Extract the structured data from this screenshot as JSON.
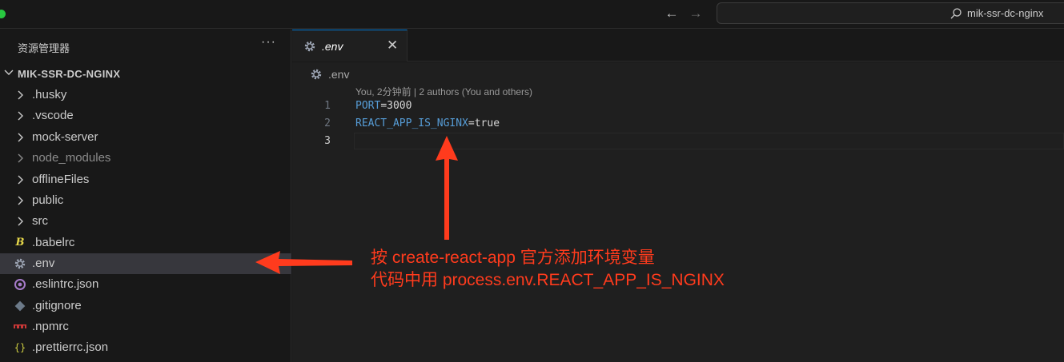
{
  "titlebar": {
    "search_text": "mik-ssr-dc-nginx",
    "back_icon": "arrow-left-icon",
    "forward_icon": "arrow-right-icon",
    "search_icon": "search-icon"
  },
  "sidebar": {
    "title": "资源管理器",
    "more": "···",
    "root_label": "MIK-SSR-DC-NGINX",
    "items": [
      {
        "label": ".husky",
        "type": "folder"
      },
      {
        "label": ".vscode",
        "type": "folder"
      },
      {
        "label": "mock-server",
        "type": "folder"
      },
      {
        "label": "node_modules",
        "type": "folder",
        "dim": true
      },
      {
        "label": "offlineFiles",
        "type": "folder"
      },
      {
        "label": "public",
        "type": "folder"
      },
      {
        "label": "src",
        "type": "folder"
      },
      {
        "label": ".babelrc",
        "type": "file",
        "icon": "babel-icon"
      },
      {
        "label": ".env",
        "type": "file",
        "icon": "gear-icon",
        "selected": true
      },
      {
        "label": ".eslintrc.json",
        "type": "file",
        "icon": "eslint-icon"
      },
      {
        "label": ".gitignore",
        "type": "file",
        "icon": "git-icon"
      },
      {
        "label": ".npmrc",
        "type": "file",
        "icon": "npm-icon"
      },
      {
        "label": ".prettierrc.json",
        "type": "file",
        "icon": "json-braces-icon"
      }
    ]
  },
  "editor": {
    "tab_label": ".env",
    "tab_close": "✕",
    "breadcrumb": ".env",
    "blame": "You, 2分钟前 | 2 authors (You and others)",
    "lines": [
      {
        "num": "1",
        "key": "PORT",
        "eq": "=",
        "value": "3000"
      },
      {
        "num": "2",
        "key": "REACT_APP_IS_NGINX",
        "eq": "=",
        "value": "true"
      },
      {
        "num": "3",
        "key": "",
        "eq": "",
        "value": ""
      }
    ]
  },
  "annotation": {
    "line1": "按 create-react-app 官方添加环境变量",
    "line2": "代码中用 process.env.REACT_APP_IS_NGINX",
    "color": "#ff3b1d"
  },
  "colors": {
    "accent": "#0078d4",
    "selected_bg": "#37373d",
    "key": "#569cd6"
  }
}
